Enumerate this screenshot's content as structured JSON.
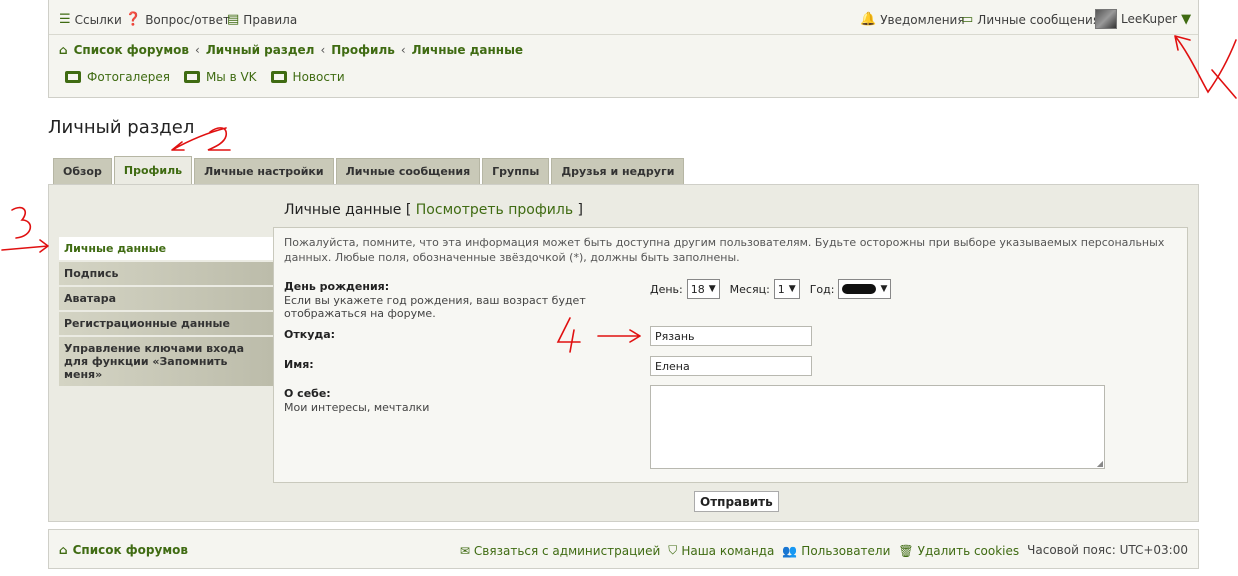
{
  "topbar": {
    "links_label": "Ссылки",
    "faq_label": "Вопрос/ответ",
    "rules_label": "Правила",
    "notifications_label": "Уведомления",
    "messages_label": "Личные сообщения",
    "username": "LeeKuper"
  },
  "breadcrumb": [
    "Список форумов",
    "Личный раздел",
    "Профиль",
    "Личные данные"
  ],
  "quicklinks": [
    "Фотогалерея",
    "Мы в VK",
    "Новости"
  ],
  "page_title": "Личный раздел",
  "tabs": [
    "Обзор",
    "Профиль",
    "Личные настройки",
    "Личные сообщения",
    "Группы",
    "Друзья и недруги"
  ],
  "active_tab": "Профиль",
  "sidenav": [
    "Личные данные",
    "Подпись",
    "Аватара",
    "Регистрационные данные",
    "Управление ключами входа для функции «Запомнить меня»"
  ],
  "section": {
    "title": "Личные данные",
    "view_profile": "Посмотреть профиль",
    "bracket_open": "[",
    "bracket_close": "]"
  },
  "notice": "Пожалуйста, помните, что эта информация может быть доступна другим пользователям. Будьте осторожны при выборе указываемых персональных данных. Любые поля, обозначенные звёздочкой (*), должны быть заполнены.",
  "form": {
    "birthday_label": "День рождения:",
    "birthday_note": "Если вы укажете год рождения, ваш возраст будет отображаться на форуме.",
    "day_label": "День:",
    "day_value": "18",
    "month_label": "Месяц:",
    "month_value": "1",
    "year_label": "Год:",
    "location_label": "Откуда:",
    "location_value": "Рязань",
    "name_label": "Имя:",
    "name_value": "Елена",
    "about_label": "О себе:",
    "about_note": "Мои интересы, мечталки",
    "submit_label": "Отправить"
  },
  "footer": {
    "home": "Список форумов",
    "contact": "Связаться с администрацией",
    "team": "Наша команда",
    "users": "Пользователи",
    "cookies": "Удалить cookies",
    "timezone": "Часовой пояс: UTC+03:00"
  },
  "colors": {
    "accent": "#3f6b12",
    "annotation": "#e01010"
  }
}
